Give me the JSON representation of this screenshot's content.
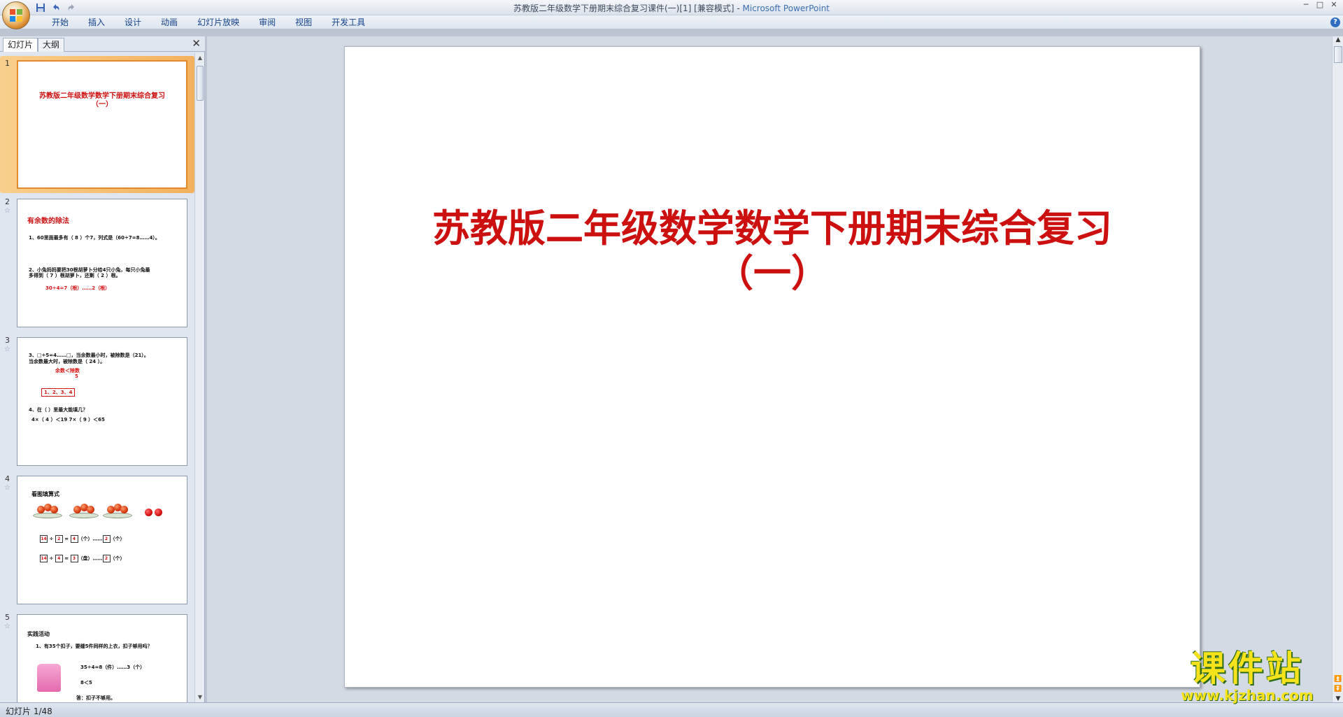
{
  "window": {
    "title": "苏教版二年级数学下册期末综合复习课件(一)[1] [兼容模式] - ",
    "app_name": "Microsoft PowerPoint",
    "controls": [
      "─",
      "□",
      "✕"
    ]
  },
  "quick_access": [
    "save-icon",
    "undo-icon",
    "redo-icon"
  ],
  "ribbon": {
    "tabs": [
      "开始",
      "插入",
      "设计",
      "动画",
      "幻灯片放映",
      "审阅",
      "视图",
      "开发工具"
    ],
    "help": "?"
  },
  "left_pane": {
    "tabs": [
      "幻灯片",
      "大纲"
    ],
    "close": "✕"
  },
  "thumbnails": [
    {
      "number": "1",
      "title": "苏教版二年级数学数学下册期末综合复习（一）"
    },
    {
      "number": "2",
      "heading": "有余数的除法",
      "line1": "1、60里面最多有（  8  ）个7，列式是（60÷7=8……4）。",
      "line2": "2、小兔妈妈要把30根胡萝卜分给4只小兔，每只小兔最",
      "line3": "多得到（  7  ）根胡萝卜，还剩（  2  ）根。",
      "line4": "30÷4=7（根）……2（根）"
    },
    {
      "number": "3",
      "line1": "3、□÷5=4……□，当余数最小时，被除数是（21）。",
      "line2": "当余数最大时，被除数是（ 24 ）。",
      "note": "余数＜除数",
      "note2": "5",
      "box": "1、2、3、4",
      "line3": "4、在（  ）里最大能填几？",
      "line4": "4×（  4  ）＜19          7×（  9  ）＜65"
    },
    {
      "number": "4",
      "heading": "看图填算式",
      "eq1": [
        "14",
        "÷",
        "2",
        "=",
        "4",
        "（个）……",
        "2",
        "（个）"
      ],
      "eq2": [
        "14",
        "÷",
        "4",
        "=",
        "3",
        "（盘）……",
        "2",
        "（个）"
      ]
    },
    {
      "number": "5",
      "heading": "实践活动",
      "line1": "1、有35个扣子，要缝5件同样的上衣，扣子够用吗？",
      "line2": "35÷4=8（件）……3（个）",
      "line3": "8＜5",
      "line4": "答：扣子不够用。"
    }
  ],
  "slide": {
    "title_line1": "苏教版二年级数学数学下册期末综合复习",
    "title_line2": "（一）",
    "title_color": "#cc1010"
  },
  "status_bar": {
    "slide_indicator": "幻灯片 1/48"
  },
  "watermark": {
    "text": "课件站",
    "url": "www.kjzhan.com"
  }
}
